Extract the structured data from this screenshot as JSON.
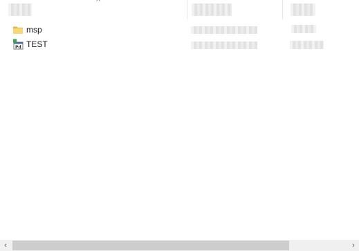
{
  "header": {
    "sort_arrow": "^"
  },
  "rows": [
    {
      "name": "msp",
      "icon": "folder-icon"
    },
    {
      "name": "TEST",
      "icon": "program-shortcut-icon"
    }
  ],
  "scrollbar": {
    "left_arrow": "‹",
    "right_arrow": "›"
  },
  "colors": {
    "folder": "#f5c84c",
    "thumb": "#cdcdcd",
    "track": "#f0f0f0"
  }
}
